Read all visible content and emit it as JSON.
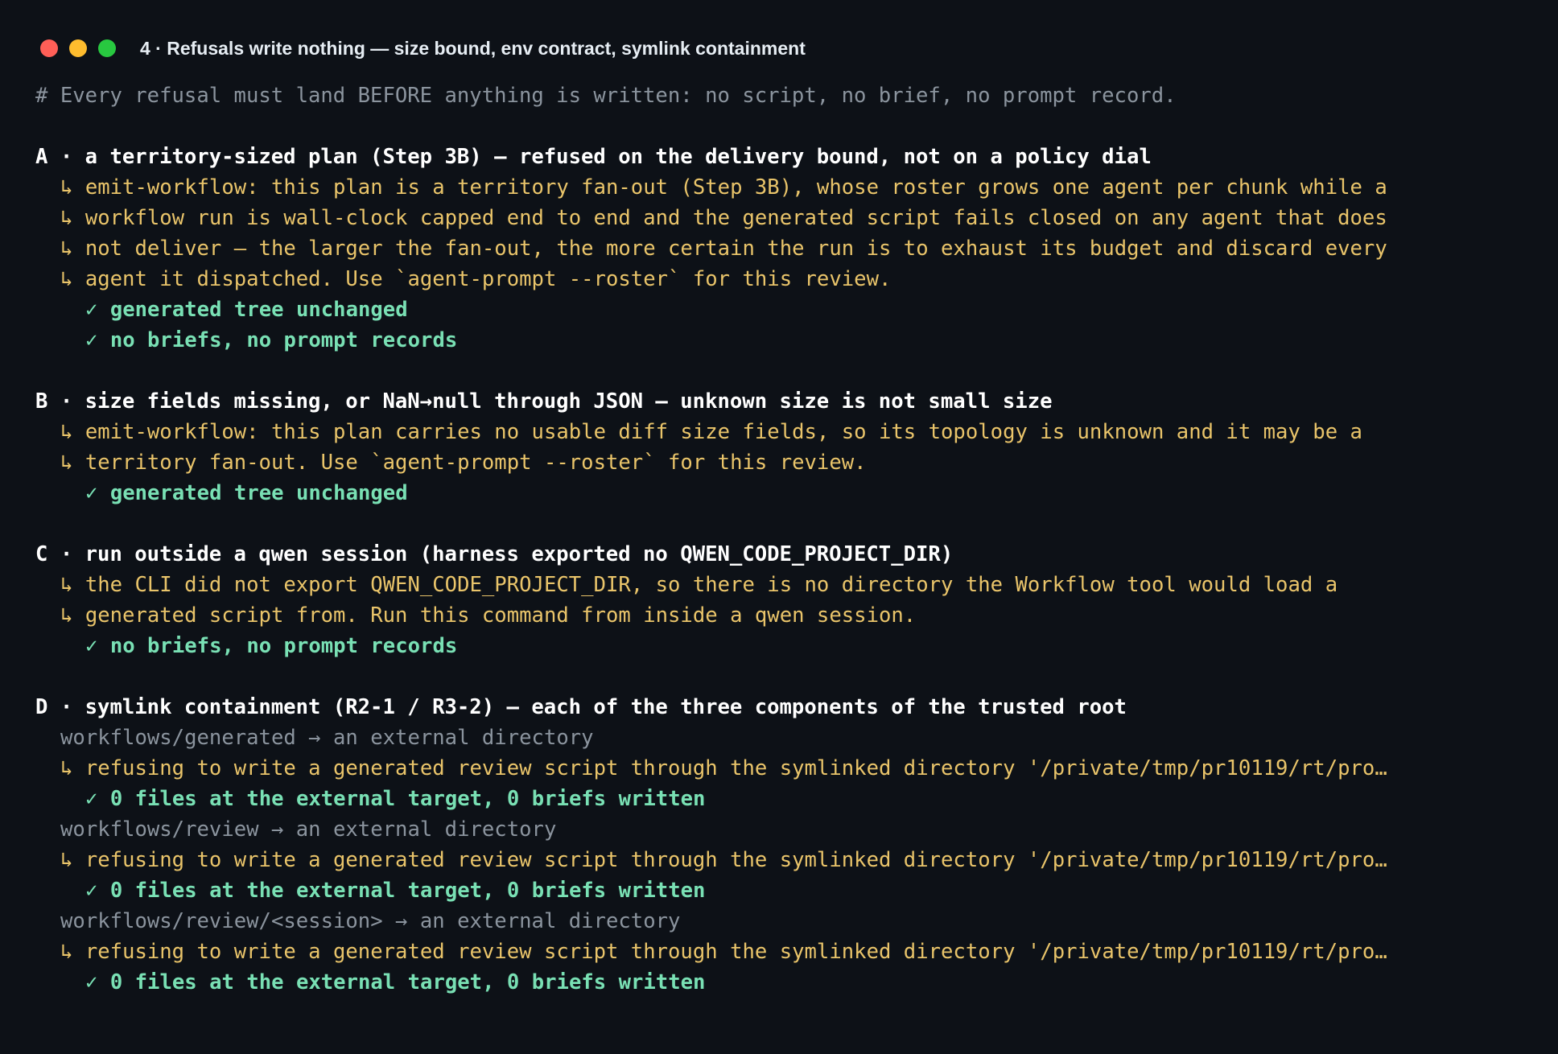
{
  "window": {
    "title": "4 · Refusals write nothing — size bound, env contract, symlink containment"
  },
  "lines": [
    {
      "kind": "comment",
      "text": "# Every refusal must land BEFORE anything is written: no script, no brief, no prompt record."
    },
    {
      "kind": "blank",
      "text": ""
    },
    {
      "kind": "heading",
      "text": "A · a territory-sized plan (Step 3B) — refused on the delivery bound, not on a policy dial"
    },
    {
      "kind": "warn",
      "text": "↳ emit-workflow: this plan is a territory fan-out (Step 3B), whose roster grows one agent per chunk while a"
    },
    {
      "kind": "warn",
      "text": "↳ workflow run is wall-clock capped end to end and the generated script fails closed on any agent that does"
    },
    {
      "kind": "warn",
      "text": "↳ not deliver — the larger the fan-out, the more certain the run is to exhaust its budget and discard every"
    },
    {
      "kind": "warn",
      "text": "↳ agent it dispatched. Use `agent-prompt --roster` for this review."
    },
    {
      "kind": "ok",
      "text": "✓ generated tree unchanged"
    },
    {
      "kind": "ok",
      "text": "✓ no briefs, no prompt records"
    },
    {
      "kind": "blank",
      "text": ""
    },
    {
      "kind": "heading",
      "text": "B · size fields missing, or NaN→null through JSON — unknown size is not small size"
    },
    {
      "kind": "warn",
      "text": "↳ emit-workflow: this plan carries no usable diff size fields, so its topology is unknown and it may be a"
    },
    {
      "kind": "warn",
      "text": "↳ territory fan-out. Use `agent-prompt --roster` for this review."
    },
    {
      "kind": "ok",
      "text": "✓ generated tree unchanged"
    },
    {
      "kind": "blank",
      "text": ""
    },
    {
      "kind": "heading",
      "text": "C · run outside a qwen session (harness exported no QWEN_CODE_PROJECT_DIR)"
    },
    {
      "kind": "warn",
      "text": "↳ the CLI did not export QWEN_CODE_PROJECT_DIR, so there is no directory the Workflow tool would load a"
    },
    {
      "kind": "warn",
      "text": "↳ generated script from. Run this command from inside a qwen session."
    },
    {
      "kind": "ok",
      "text": "✓ no briefs, no prompt records"
    },
    {
      "kind": "blank",
      "text": ""
    },
    {
      "kind": "heading",
      "text": "D · symlink containment (R2-1 / R3-2) — each of the three components of the trusted root"
    },
    {
      "kind": "dim",
      "text": "workflows/generated → an external directory"
    },
    {
      "kind": "warn",
      "trunc": true,
      "text": "↳ refusing to write a generated review script through the symlinked directory '/private/tmp/pr10119/rt/pro…"
    },
    {
      "kind": "ok",
      "text": "✓ 0 files at the external target, 0 briefs written"
    },
    {
      "kind": "dim",
      "text": "workflows/review → an external directory"
    },
    {
      "kind": "warn",
      "trunc": true,
      "text": "↳ refusing to write a generated review script through the symlinked directory '/private/tmp/pr10119/rt/pro…"
    },
    {
      "kind": "ok",
      "text": "✓ 0 files at the external target, 0 briefs written"
    },
    {
      "kind": "dim",
      "text": "workflows/review/<session> → an external directory"
    },
    {
      "kind": "warn",
      "trunc": true,
      "text": "↳ refusing to write a generated review script through the symlinked directory '/private/tmp/pr10119/rt/pro…"
    },
    {
      "kind": "ok",
      "text": "✓ 0 files at the external target, 0 briefs written"
    }
  ]
}
